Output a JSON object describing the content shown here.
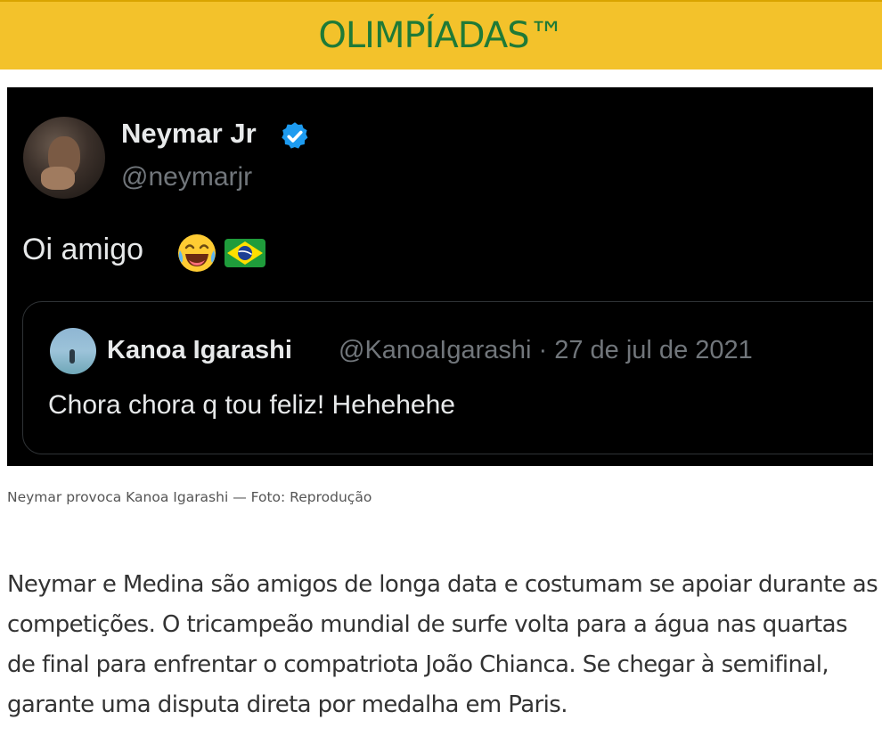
{
  "header": {
    "title": "OLIMPÍADAS™"
  },
  "tweet": {
    "author_name": "Neymar Jr",
    "author_handle": "@neymarjr",
    "text": "Oi amigo",
    "icons": [
      "avatar-photo",
      "verified-badge-icon",
      "laughing-emoji-icon",
      "brazil-flag-icon"
    ],
    "quoted": {
      "author_name": "Kanoa Igarashi",
      "author_handle": "@KanoaIgarashi",
      "date": "27 de jul de 2021",
      "meta": "@KanoaIgarashi · 27 de jul de 2021",
      "text": "Chora chora q tou feliz! Hehehehe"
    }
  },
  "caption": "Neymar provoca Kanoa Igarashi — Foto: Reprodução",
  "article": {
    "paragraph": "Neymar e Medina são amigos de longa data e costumam se apoiar durante as competições. O tricampeão mundial de surfe volta para a água nas quartas de final para enfrentar o compatriota João Chianca. Se chegar à semifinal, garante uma disputa direta por medalha em Paris."
  },
  "colors": {
    "header_bg": "#f3c22b",
    "header_text": "#1f7a37",
    "tweet_bg": "#000000",
    "verified_blue": "#1d9bf0"
  }
}
